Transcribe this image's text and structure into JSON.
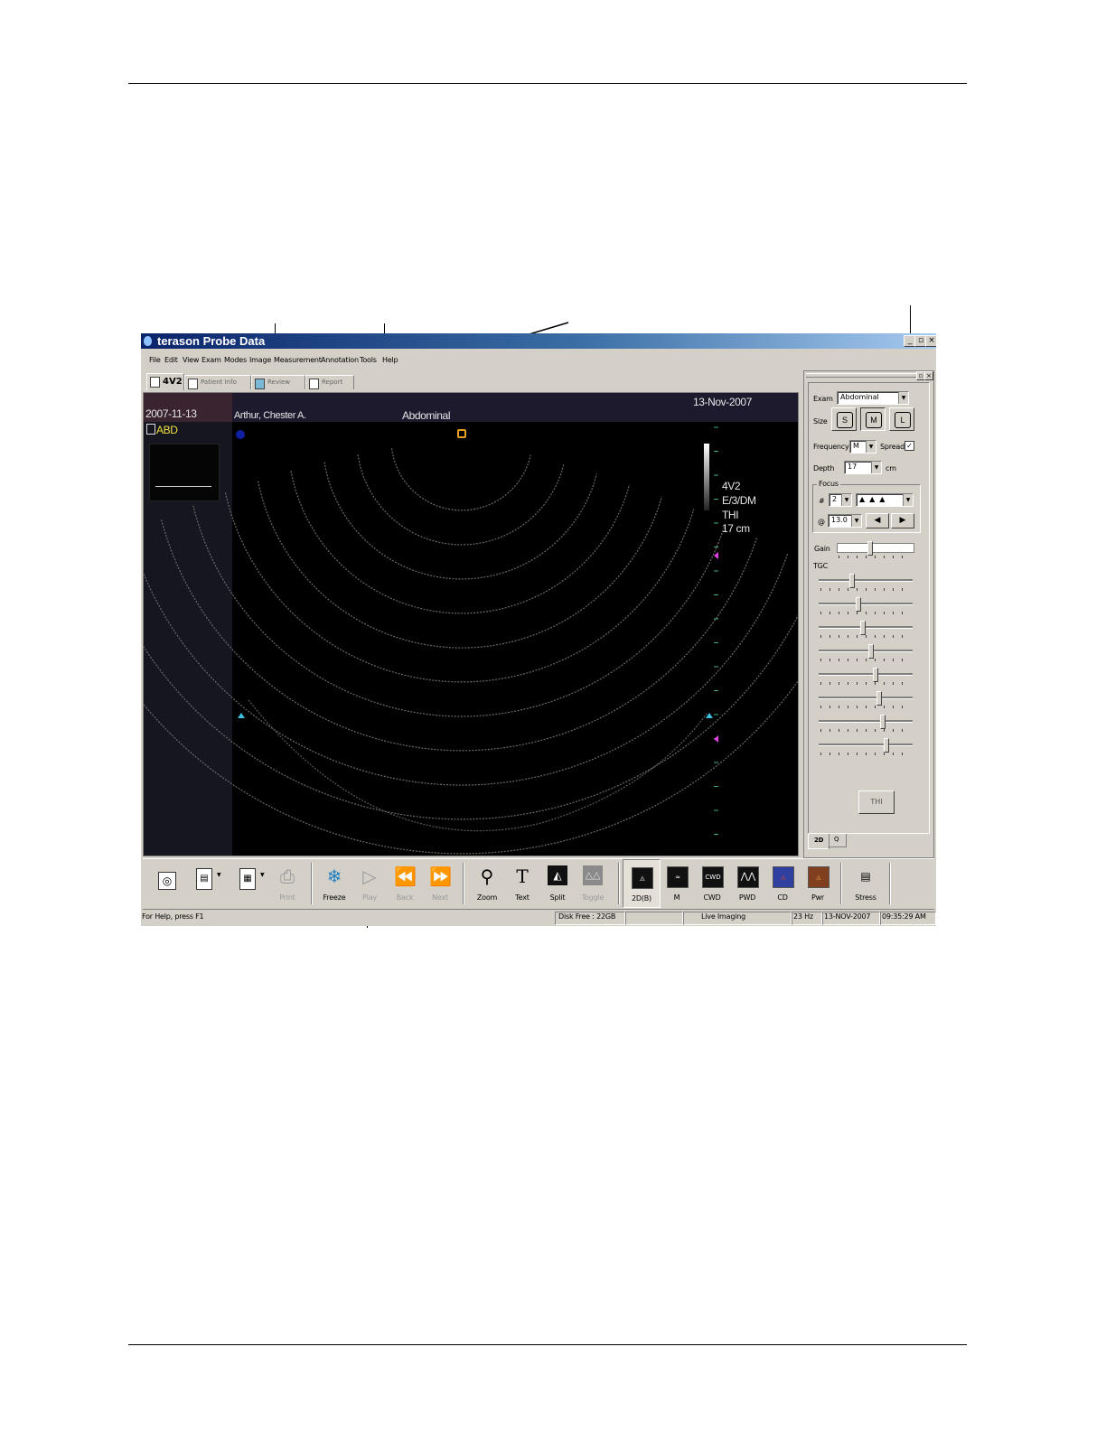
{
  "window": {
    "title": "terason Probe Data",
    "min_symbol": "_",
    "max_symbol": "▫",
    "close_symbol": "×"
  },
  "menu": [
    "File",
    "Edit",
    "View",
    "Exam",
    "Modes",
    "Image",
    "Measurement",
    "Annotation",
    "Tools",
    "Help"
  ],
  "tabs": {
    "probe": "4V2",
    "patient_info": "Patient Info",
    "review": "Review",
    "report": "Report"
  },
  "image": {
    "study_date": "2007-11-13",
    "thumb_label": "ABD",
    "patient_name": "Arthur, Chester A.",
    "exam_label": "Abdominal",
    "date": "13-Nov-2007",
    "probe": "4V2",
    "mode_info": "E/3/DM",
    "harmonic": "THI",
    "depth": "17 cm"
  },
  "panel": {
    "exam_label": "Exam",
    "exam_value": "Abdominal",
    "size_label": "Size",
    "size_options": [
      "S",
      "M",
      "L"
    ],
    "frequency_label": "Frequency",
    "frequency_value": "M",
    "spread_label": "Spread",
    "spread_checked": true,
    "depth_label": "Depth",
    "depth_value": "17",
    "depth_unit": "cm",
    "focus_label": "Focus",
    "focus_count_label": "#",
    "focus_count": "2",
    "focus_at_label": "@",
    "focus_at_value": "13.0",
    "gain_label": "Gain",
    "gain_level": 0.42,
    "tgc_label": "TGC",
    "tgc_levels": [
      0.34,
      0.41,
      0.46,
      0.55,
      0.6,
      0.64,
      0.68,
      0.72
    ],
    "thi_label": "THI",
    "tab_2d": "2D",
    "tab_q": "Q"
  },
  "toolbar": {
    "print": "Print",
    "freeze": "Freeze",
    "play": "Play",
    "back": "Back",
    "next": "Next",
    "zoom": "Zoom",
    "text": "Text",
    "split": "Split",
    "toggle": "Toggle",
    "mode_2d": "2D(B)",
    "mode_m": "M",
    "mode_cwd": "CWD",
    "mode_pwd": "PWD",
    "mode_cd": "CD",
    "mode_pwr": "Pwr",
    "stress": "Stress"
  },
  "status": {
    "help": "For Help, press F1",
    "disk": "Disk Free : 22GB",
    "state": "Live Imaging",
    "rate": "23 Hz",
    "date": "13-NOV-2007",
    "time": "09:35:29 AM"
  },
  "colors": {
    "title_start": "#0a246a",
    "title_end": "#a6caf0",
    "marker_cyan": "#40c0e0",
    "marker_magenta": "#e040e0",
    "scale_green": "#40b080",
    "focus_orange": "#e8a020"
  }
}
